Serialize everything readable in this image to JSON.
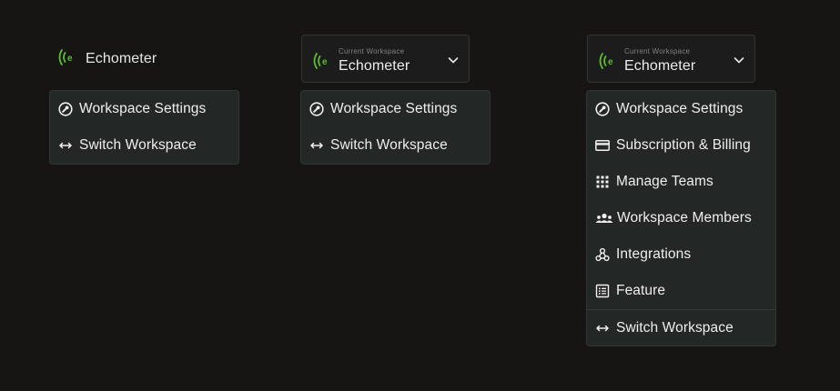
{
  "brand": {
    "name": "Echometer",
    "accent": "#5fbe2b"
  },
  "header": {
    "caption": "Current Workspace",
    "workspace_name": "Echometer"
  },
  "menu": {
    "workspace_settings": "Workspace Settings",
    "subscription_billing": "Subscription & Billing",
    "manage_teams": "Manage Teams",
    "workspace_members": "Workspace Members",
    "integrations": "Integrations",
    "feature": "Feature",
    "switch_workspace": "Switch Workspace"
  },
  "icons": {
    "logo": "echometer-logo-icon",
    "chevron": "chevron-down-icon",
    "settings": "wrench-circle-icon",
    "billing": "credit-card-icon",
    "teams": "grid-dots-icon",
    "members": "users-icon",
    "integrations": "webhook-icon",
    "feature": "list-icon",
    "switch": "arrows-left-right-icon"
  }
}
